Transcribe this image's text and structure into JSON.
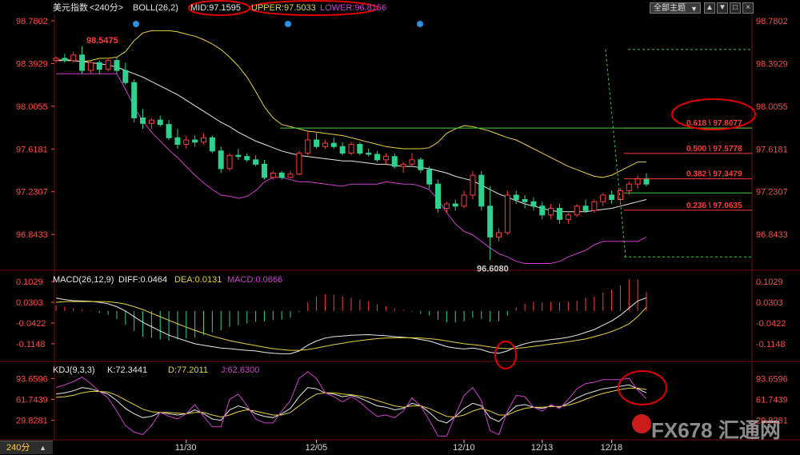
{
  "header": {
    "symbol": "美元指数",
    "period": "<240分>",
    "boll": "BOLL(26,2)",
    "mid": "MID:97.1595",
    "upper": "UPPER:97.5033",
    "lower": "LOWER:96.8156"
  },
  "toolbar": {
    "theme_label": "全部主题",
    "dropdown_arrow": "▼",
    "btn_up": "▲",
    "btn_down": "▼",
    "btn_max": "□",
    "btn_close": "×"
  },
  "price_axis": {
    "ticks": [
      "98.7802",
      "98.3929",
      "98.0055",
      "97.6181",
      "97.2307",
      "96.8433"
    ]
  },
  "macd_header": {
    "title": "MACD(26,12,9)",
    "diff": "DIFF:0.0464",
    "dea": "DEA:0.0131",
    "macd": "MACD:0.0666"
  },
  "macd_axis": {
    "ticks": [
      "0.1029",
      "0.0303",
      "-0.0422",
      "-0.1148"
    ]
  },
  "kdj_header": {
    "title": "KDJ(9,3,3)",
    "k": "K:72.3441",
    "d": "D:77.2011",
    "j": "J:62.6300"
  },
  "kdj_axis": {
    "ticks": [
      "93.6596",
      "61.7439",
      "29.8281"
    ]
  },
  "date_axis": {
    "labels": [
      "11/30",
      "12/05",
      "12/10",
      "12/13",
      "12/18"
    ]
  },
  "period_button": "240分",
  "watermark": "FX678 汇通网",
  "colors": {
    "up": "#ff3b3b",
    "down": "#2fd18f",
    "boll_upper": "#e5d33c",
    "boll_mid": "#e8e8e8",
    "boll_lower": "#d03ed0",
    "fib": "#ff3b3b",
    "fib_green": "#3ecf3e",
    "annotation": "#e00000"
  },
  "chart_data": [
    {
      "type": "candlestick",
      "title": "美元指数 BOLL(26,2)",
      "ylim": [
        96.62,
        98.78
      ],
      "high_label": "98.5475",
      "low_label": "96.6080",
      "fibonacci": [
        {
          "label": "0.618 \\ 97.8077",
          "value": 97.8077
        },
        {
          "label": "0.500 \\ 97.5778",
          "value": 97.5778
        },
        {
          "label": "0.382 \\ 97.3479",
          "value": 97.3479
        },
        {
          "label": "0.236 \\ 97.0635",
          "value": 97.0635
        }
      ],
      "candles": [
        [
          98.42,
          98.46,
          98.4,
          98.44
        ],
        [
          98.44,
          98.48,
          98.4,
          98.42
        ],
        [
          98.42,
          98.5,
          98.4,
          98.47
        ],
        [
          98.47,
          98.55,
          98.3,
          98.33
        ],
        [
          98.33,
          98.42,
          98.3,
          98.4
        ],
        [
          98.4,
          98.42,
          98.3,
          98.34
        ],
        [
          98.34,
          98.44,
          98.32,
          98.42
        ],
        [
          98.42,
          98.45,
          98.3,
          98.33
        ],
        [
          98.33,
          98.4,
          98.2,
          98.22
        ],
        [
          98.22,
          98.25,
          97.86,
          97.9
        ],
        [
          97.9,
          97.98,
          97.8,
          97.85
        ],
        [
          97.85,
          97.9,
          97.8,
          97.88
        ],
        [
          97.88,
          97.92,
          97.82,
          97.84
        ],
        [
          97.84,
          97.88,
          97.7,
          97.72
        ],
        [
          97.72,
          97.8,
          97.62,
          97.66
        ],
        [
          97.66,
          97.74,
          97.62,
          97.7
        ],
        [
          97.7,
          97.74,
          97.64,
          97.68
        ],
        [
          97.68,
          97.76,
          97.66,
          97.72
        ],
        [
          97.72,
          97.74,
          97.58,
          97.6
        ],
        [
          97.6,
          97.64,
          97.4,
          97.44
        ],
        [
          97.44,
          97.58,
          97.42,
          97.56
        ],
        [
          97.56,
          97.62,
          97.52,
          97.55
        ],
        [
          97.55,
          97.58,
          97.5,
          97.52
        ],
        [
          97.52,
          97.56,
          97.46,
          97.48
        ],
        [
          97.48,
          97.52,
          97.34,
          97.36
        ],
        [
          97.36,
          97.42,
          97.34,
          97.4
        ],
        [
          97.4,
          97.42,
          97.34,
          97.36
        ],
        [
          97.36,
          97.42,
          97.35,
          97.39
        ],
        [
          97.39,
          97.6,
          97.38,
          97.58
        ],
        [
          97.58,
          97.78,
          97.56,
          97.7
        ],
        [
          97.7,
          97.76,
          97.62,
          97.64
        ],
        [
          97.64,
          97.7,
          97.62,
          97.67
        ],
        [
          97.67,
          97.72,
          97.62,
          97.64
        ],
        [
          97.64,
          97.68,
          97.56,
          97.58
        ],
        [
          97.58,
          97.68,
          97.56,
          97.66
        ],
        [
          97.66,
          97.68,
          97.56,
          97.58
        ],
        [
          97.58,
          97.62,
          97.55,
          97.57
        ],
        [
          97.57,
          97.6,
          97.5,
          97.52
        ],
        [
          97.52,
          97.58,
          97.48,
          97.55
        ],
        [
          97.55,
          97.58,
          97.44,
          97.46
        ],
        [
          97.46,
          97.5,
          97.4,
          97.48
        ],
        [
          97.48,
          97.58,
          97.46,
          97.52
        ],
        [
          97.52,
          97.54,
          97.4,
          97.43
        ],
        [
          97.43,
          97.46,
          97.26,
          97.3
        ],
        [
          97.3,
          97.34,
          97.04,
          97.08
        ],
        [
          97.08,
          97.14,
          97.04,
          97.12
        ],
        [
          97.12,
          97.16,
          97.06,
          97.1
        ],
        [
          97.1,
          97.24,
          97.08,
          97.2
        ],
        [
          97.2,
          97.42,
          97.16,
          97.38
        ],
        [
          97.38,
          97.42,
          97.06,
          97.1
        ],
        [
          97.1,
          97.28,
          96.61,
          96.82
        ],
        [
          96.82,
          96.9,
          96.78,
          96.86
        ],
        [
          96.86,
          97.24,
          96.84,
          97.2
        ],
        [
          97.2,
          97.24,
          97.12,
          97.16
        ],
        [
          97.16,
          97.2,
          97.08,
          97.14
        ],
        [
          97.14,
          97.18,
          97.06,
          97.1
        ],
        [
          97.1,
          97.14,
          96.98,
          97.02
        ],
        [
          97.02,
          97.12,
          96.98,
          97.08
        ],
        [
          97.08,
          97.12,
          96.94,
          96.98
        ],
        [
          96.98,
          97.04,
          96.94,
          97.02
        ],
        [
          97.02,
          97.12,
          97.0,
          97.1
        ],
        [
          97.1,
          97.16,
          97.04,
          97.06
        ],
        [
          97.06,
          97.16,
          97.04,
          97.14
        ],
        [
          97.14,
          97.22,
          97.1,
          97.2
        ],
        [
          97.2,
          97.24,
          97.12,
          97.16
        ],
        [
          97.16,
          97.26,
          97.14,
          97.24
        ],
        [
          97.24,
          97.32,
          97.2,
          97.3
        ],
        [
          97.3,
          97.38,
          97.26,
          97.35
        ],
        [
          97.35,
          97.4,
          97.28,
          97.3
        ]
      ],
      "boll_upper": [
        98.42,
        98.43,
        98.42,
        98.41,
        98.42,
        98.44,
        98.44,
        98.45,
        98.5,
        98.6,
        98.67,
        98.69,
        98.69,
        98.69,
        98.68,
        98.66,
        98.64,
        98.61,
        98.57,
        98.52,
        98.45,
        98.37,
        98.27,
        98.14,
        98.0,
        97.9,
        97.84,
        97.82,
        97.8,
        97.78,
        97.77,
        97.76,
        97.75,
        97.74,
        97.72,
        97.7,
        97.68,
        97.66,
        97.64,
        97.63,
        97.62,
        97.62,
        97.62,
        97.63,
        97.68,
        97.76,
        97.8,
        97.83,
        97.82,
        97.8,
        97.78,
        97.75,
        97.72,
        97.7,
        97.66,
        97.62,
        97.58,
        97.54,
        97.5,
        97.46,
        97.43,
        97.4,
        97.37,
        97.36,
        97.38,
        97.42,
        97.46,
        97.5,
        97.5
      ],
      "boll_mid": [
        98.42,
        98.42,
        98.42,
        98.41,
        98.4,
        98.39,
        98.38,
        98.36,
        98.33,
        98.3,
        98.27,
        98.23,
        98.19,
        98.15,
        98.11,
        98.06,
        98.01,
        97.96,
        97.91,
        97.86,
        97.82,
        97.77,
        97.73,
        97.69,
        97.66,
        97.63,
        97.6,
        97.58,
        97.56,
        97.55,
        97.54,
        97.53,
        97.52,
        97.51,
        97.51,
        97.5,
        97.49,
        97.48,
        97.48,
        97.47,
        97.46,
        97.46,
        97.45,
        97.44,
        97.42,
        97.4,
        97.37,
        97.35,
        97.33,
        97.29,
        97.25,
        97.21,
        97.18,
        97.15,
        97.12,
        97.1,
        97.08,
        97.06,
        97.05,
        97.05,
        97.05,
        97.05,
        97.06,
        97.07,
        97.08,
        97.1,
        97.12,
        97.14,
        97.16
      ],
      "boll_lower": [
        98.3,
        98.3,
        98.3,
        98.3,
        98.3,
        98.3,
        98.3,
        98.3,
        98.16,
        98.0,
        97.87,
        97.77,
        97.69,
        97.61,
        97.54,
        97.46,
        97.38,
        97.31,
        97.25,
        97.2,
        97.19,
        97.17,
        97.19,
        97.24,
        97.32,
        97.36,
        97.36,
        97.34,
        97.32,
        97.32,
        97.31,
        97.3,
        97.29,
        97.28,
        97.3,
        97.3,
        97.3,
        97.3,
        97.32,
        97.31,
        97.3,
        97.3,
        97.28,
        97.25,
        97.16,
        97.04,
        96.94,
        96.87,
        96.84,
        96.78,
        96.72,
        96.67,
        96.64,
        96.6,
        96.58,
        96.58,
        96.58,
        96.58,
        96.6,
        96.64,
        96.67,
        96.7,
        96.75,
        96.78,
        96.78,
        96.78,
        96.78,
        96.78,
        96.82
      ]
    },
    {
      "type": "bar",
      "title": "MACD(26,12,9)",
      "ylim": [
        -0.16,
        0.12
      ],
      "series": [
        {
          "name": "DIFF",
          "values": [
            0.045,
            0.04,
            0.036,
            0.035,
            0.034,
            0.03,
            0.025,
            0.015,
            0.0,
            -0.02,
            -0.04,
            -0.055,
            -0.07,
            -0.085,
            -0.095,
            -0.105,
            -0.115,
            -0.12,
            -0.125,
            -0.13,
            -0.132,
            -0.135,
            -0.138,
            -0.14,
            -0.145,
            -0.148,
            -0.15,
            -0.15,
            -0.14,
            -0.12,
            -0.105,
            -0.095,
            -0.09,
            -0.088,
            -0.085,
            -0.084,
            -0.083,
            -0.085,
            -0.087,
            -0.09,
            -0.092,
            -0.095,
            -0.1,
            -0.105,
            -0.115,
            -0.125,
            -0.13,
            -0.133,
            -0.13,
            -0.135,
            -0.145,
            -0.148,
            -0.14,
            -0.125,
            -0.115,
            -0.108,
            -0.105,
            -0.1,
            -0.097,
            -0.092,
            -0.085,
            -0.075,
            -0.065,
            -0.05,
            -0.035,
            -0.015,
            0.01,
            0.035,
            0.046
          ]
        },
        {
          "name": "DEA",
          "values": [
            0.03,
            0.033,
            0.033,
            0.033,
            0.033,
            0.033,
            0.032,
            0.029,
            0.024,
            0.015,
            0.005,
            -0.008,
            -0.02,
            -0.033,
            -0.045,
            -0.057,
            -0.068,
            -0.078,
            -0.088,
            -0.096,
            -0.104,
            -0.11,
            -0.116,
            -0.121,
            -0.127,
            -0.132,
            -0.135,
            -0.138,
            -0.138,
            -0.135,
            -0.13,
            -0.124,
            -0.118,
            -0.113,
            -0.108,
            -0.104,
            -0.1,
            -0.097,
            -0.095,
            -0.094,
            -0.094,
            -0.094,
            -0.095,
            -0.097,
            -0.1,
            -0.105,
            -0.11,
            -0.115,
            -0.118,
            -0.121,
            -0.126,
            -0.13,
            -0.132,
            -0.131,
            -0.128,
            -0.124,
            -0.12,
            -0.116,
            -0.112,
            -0.108,
            -0.103,
            -0.098,
            -0.09,
            -0.082,
            -0.072,
            -0.06,
            -0.045,
            -0.02,
            0.013
          ]
        },
        {
          "name": "MACD",
          "values": [
            0.02,
            0.015,
            0.01,
            0.005,
            0.002,
            -0.006,
            -0.014,
            -0.028,
            -0.048,
            -0.07,
            -0.09,
            -0.094,
            -0.1,
            -0.104,
            -0.1,
            -0.096,
            -0.094,
            -0.084,
            -0.074,
            -0.068,
            -0.056,
            -0.05,
            -0.044,
            -0.038,
            -0.036,
            -0.032,
            -0.03,
            -0.024,
            -0.004,
            0.03,
            0.05,
            0.058,
            0.056,
            0.05,
            0.046,
            0.04,
            0.034,
            0.024,
            0.016,
            0.008,
            0.004,
            -0.002,
            -0.01,
            -0.016,
            -0.03,
            -0.04,
            -0.04,
            -0.036,
            -0.024,
            -0.028,
            -0.038,
            -0.036,
            -0.016,
            0.012,
            0.026,
            0.032,
            0.03,
            0.032,
            0.03,
            0.032,
            0.036,
            0.046,
            0.05,
            0.064,
            0.074,
            0.09,
            0.11,
            0.11,
            0.067
          ]
        }
      ]
    },
    {
      "type": "line",
      "title": "KDJ(9,3,3)",
      "ylim": [
        10,
        110
      ],
      "series": [
        {
          "name": "K",
          "values": [
            70,
            72,
            75,
            80,
            78,
            74,
            70,
            60,
            48,
            40,
            34,
            36,
            42,
            40,
            38,
            40,
            46,
            40,
            32,
            30,
            46,
            52,
            48,
            40,
            36,
            34,
            40,
            48,
            66,
            80,
            78,
            72,
            70,
            66,
            68,
            64,
            58,
            52,
            50,
            46,
            48,
            56,
            52,
            42,
            30,
            26,
            36,
            48,
            56,
            52,
            34,
            28,
            40,
            52,
            54,
            50,
            48,
            52,
            50,
            56,
            64,
            70,
            74,
            78,
            80,
            82,
            84,
            78,
            72
          ]
        },
        {
          "name": "D",
          "values": [
            65,
            66,
            68,
            72,
            74,
            74,
            73,
            68,
            61,
            54,
            47,
            43,
            42,
            42,
            41,
            40,
            42,
            42,
            38,
            35,
            38,
            43,
            46,
            44,
            41,
            38,
            38,
            42,
            52,
            62,
            70,
            72,
            72,
            70,
            69,
            67,
            64,
            60,
            56,
            52,
            50,
            52,
            52,
            48,
            42,
            36,
            35,
            38,
            44,
            48,
            44,
            38,
            38,
            44,
            48,
            50,
            50,
            51,
            51,
            53,
            57,
            62,
            67,
            71,
            74,
            77,
            79,
            79,
            77
          ]
        },
        {
          "name": "J",
          "values": [
            80,
            84,
            89,
            96,
            86,
            74,
            64,
            44,
            22,
            12,
            8,
            22,
            42,
            36,
            32,
            40,
            54,
            36,
            20,
            20,
            62,
            70,
            52,
            32,
            26,
            26,
            44,
            60,
            94,
            104,
            94,
            72,
            66,
            58,
            66,
            58,
            46,
            36,
            38,
            34,
            44,
            64,
            52,
            30,
            6,
            6,
            38,
            68,
            80,
            60,
            14,
            8,
            44,
            68,
            66,
            50,
            44,
            54,
            48,
            62,
            78,
            86,
            88,
            92,
            92,
            92,
            94,
            76,
            63
          ]
        }
      ]
    }
  ]
}
